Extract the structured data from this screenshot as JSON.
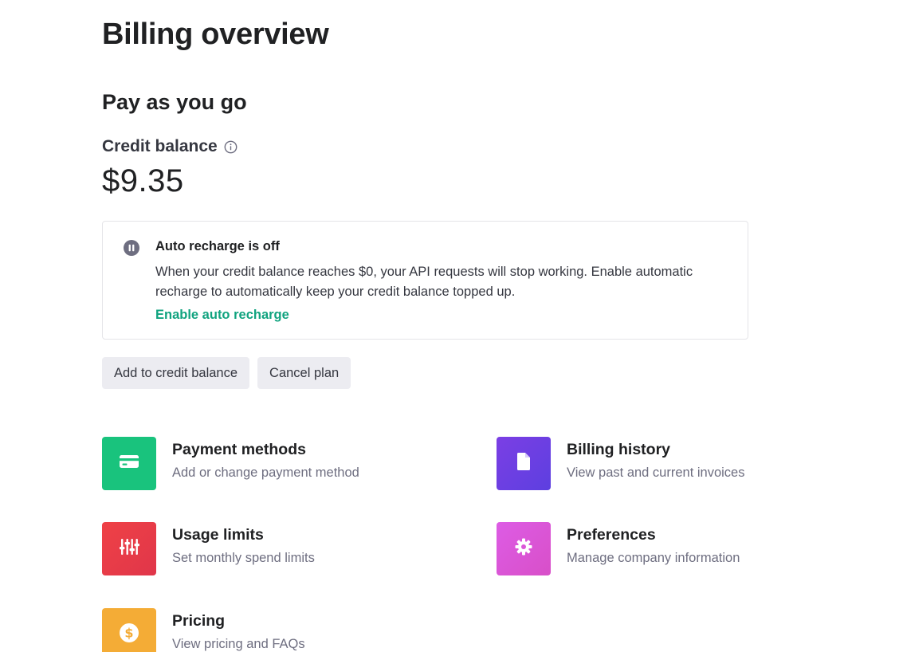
{
  "page": {
    "title": "Billing overview"
  },
  "plan": {
    "title": "Pay as you go",
    "balance_label": "Credit balance",
    "balance_amount": "$9.35"
  },
  "notice": {
    "icon": "pause-circle-icon",
    "title": "Auto recharge is off",
    "body": "When your credit balance reaches $0, your API requests will stop working. Enable automatic recharge to automatically keep your credit balance topped up.",
    "link": "Enable auto recharge"
  },
  "buttons": {
    "add_credit": "Add to credit balance",
    "cancel_plan": "Cancel plan"
  },
  "tiles": [
    {
      "title": "Payment methods",
      "description": "Add or change payment method",
      "icon": "credit-card-icon",
      "color": "#19c37d"
    },
    {
      "title": "Billing history",
      "description": "View past and current invoices",
      "icon": "document-icon",
      "color": "#6e3fe0"
    },
    {
      "title": "Usage limits",
      "description": "Set monthly spend limits",
      "icon": "sliders-icon",
      "color": "#ef4146"
    },
    {
      "title": "Preferences",
      "description": "Manage company information",
      "icon": "gear-icon",
      "color": "#dd5ce5"
    },
    {
      "title": "Pricing",
      "description": "View pricing and FAQs",
      "icon": "dollar-coin-icon",
      "color": "#f4ac36"
    }
  ],
  "colors": {
    "accent_link": "#10a37f",
    "button_bg": "#ececf1",
    "notice_icon": "#6e6e80"
  }
}
